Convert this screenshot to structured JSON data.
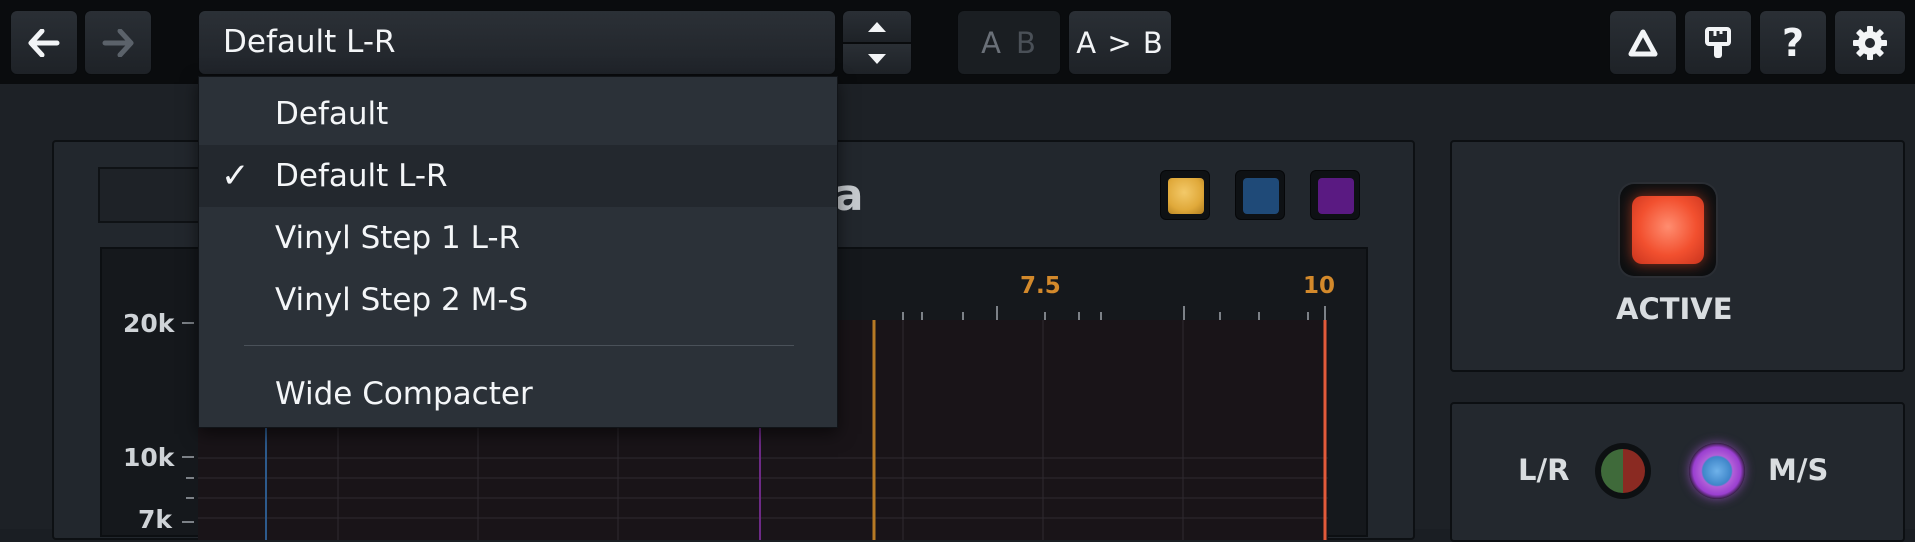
{
  "toolbar": {
    "preset_name": "Default L-R",
    "ab_a": "A",
    "ab_b": "B",
    "copy_ab": "A > B"
  },
  "dropdown": {
    "items": [
      {
        "label": "Default",
        "checked": false
      },
      {
        "label": "Default L-R",
        "checked": true
      },
      {
        "label": "Vinyl Step 1 L-R",
        "checked": false
      },
      {
        "label": "Vinyl Step 2 M-S",
        "checked": false
      },
      {
        "label": "Wide Compacter",
        "checked": false
      }
    ],
    "check_mark": "✓"
  },
  "panel": {
    "brand_fragment": "ora",
    "scale_labels": [
      "7.5",
      "10"
    ],
    "y_labels": [
      "20k",
      "10k",
      "7k"
    ],
    "active_label": "ACTIVE",
    "lr_label": "L/R",
    "ms_label": "M/S"
  },
  "colors": {
    "swatch_gold": "#e0a93a",
    "swatch_blue": "#1f4a78",
    "swatch_purple": "#5a1a82",
    "scale_accent": "#d3892b",
    "active_red": "#f2502f"
  }
}
